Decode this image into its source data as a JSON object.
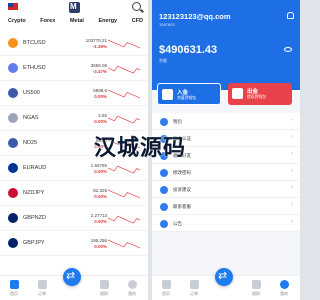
{
  "left_screen": {
    "tabs": [
      "Crypto",
      "Forex",
      "Metal",
      "Energy",
      "CFD"
    ],
    "rows": [
      {
        "symbol": "BTCUSD",
        "price": "103770.21",
        "change": "-1.36%",
        "icon_color": "#f7931a"
      },
      {
        "symbol": "ETHUSD",
        "price": "3656.08",
        "change": "-3.47%",
        "icon_color": "#627eea"
      },
      {
        "symbol": "US500",
        "price": "5898.6",
        "change": "0.00%",
        "icon_color": "#3c5aa6"
      },
      {
        "symbol": "NGAS",
        "price": "2.55",
        "change": "0.00%",
        "icon_color": "#9aa7b8"
      },
      {
        "symbol": "ND25",
        "price": "882.4",
        "change": "0.00%",
        "icon_color": "#3c5aa6"
      },
      {
        "symbol": "EURAUD",
        "price": "1.66765",
        "change": "0.00%",
        "icon_color": "#003399"
      },
      {
        "symbol": "NZDJPY",
        "price": "82.328",
        "change": "0.00%",
        "icon_color": "#c8102e"
      },
      {
        "symbol": "GBPNZD",
        "price": "2.27713",
        "change": "0.00%",
        "icon_color": "#012169"
      },
      {
        "symbol": "GBPJPY",
        "price": "195.256",
        "change": "0.00%",
        "icon_color": "#012169"
      }
    ],
    "nav": [
      {
        "label": "首页",
        "icon": "home-icon"
      },
      {
        "label": "订单",
        "icon": "order-icon"
      },
      {
        "label": "",
        "icon": "trade-icon"
      },
      {
        "label": "理财",
        "icon": "finance-icon"
      },
      {
        "label": "我的",
        "icon": "profile-icon"
      }
    ]
  },
  "right_screen": {
    "email": "123123123@qq.com",
    "uid": "1087603",
    "balance": "$490631.43",
    "balance_label": "余额",
    "deposit": {
      "title": "入金",
      "subtitle": "充值到钱包"
    },
    "withdraw": {
      "title": "出金",
      "subtitle": "提现到钱包"
    },
    "menu": [
      "钱包",
      "实名认证",
      "邀请好友",
      "修改密码",
      "投诉建议",
      "联系客服",
      "公告"
    ],
    "nav": [
      {
        "label": "首页",
        "icon": "home-icon"
      },
      {
        "label": "订单",
        "icon": "order-icon"
      },
      {
        "label": "",
        "icon": "trade-icon"
      },
      {
        "label": "理财",
        "icon": "finance-icon"
      },
      {
        "label": "我的",
        "icon": "profile-icon"
      }
    ]
  },
  "watermark": "汉城源码",
  "colors": {
    "primary": "#1e6fe6",
    "down": "#e03b3b",
    "withdraw": "#e8424a"
  }
}
